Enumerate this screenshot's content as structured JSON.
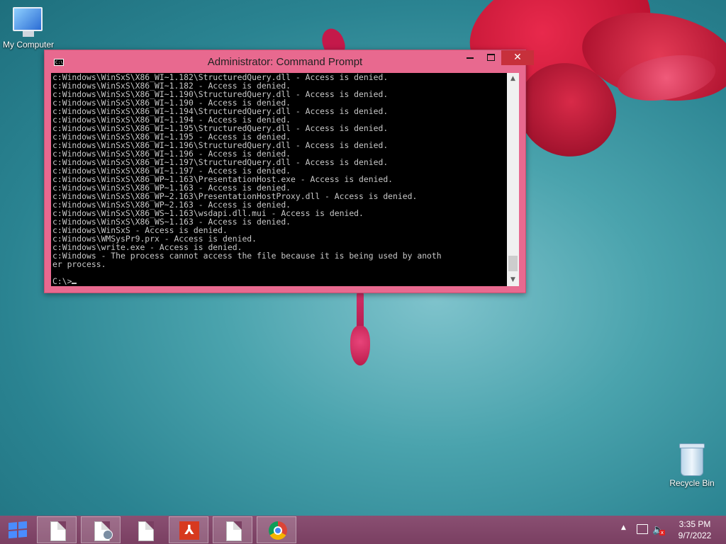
{
  "desktop": {
    "icons": [
      {
        "label": "My Computer"
      },
      {
        "label": "Recycle Bin"
      }
    ]
  },
  "window": {
    "title": "Administrator: Command Prompt",
    "icon_text": "C:\\",
    "controls": {
      "minimize": "",
      "maximize": "",
      "close": "✕"
    },
    "console_lines": [
      "c:Windows\\WinSxS\\X86_WI~1.182\\StructuredQuery.dll - Access is denied.",
      "c:Windows\\WinSxS\\X86_WI~1.182 - Access is denied.",
      "c:Windows\\WinSxS\\X86_WI~1.190\\StructuredQuery.dll - Access is denied.",
      "c:Windows\\WinSxS\\X86_WI~1.190 - Access is denied.",
      "c:Windows\\WinSxS\\X86_WI~1.194\\StructuredQuery.dll - Access is denied.",
      "c:Windows\\WinSxS\\X86_WI~1.194 - Access is denied.",
      "c:Windows\\WinSxS\\X86_WI~1.195\\StructuredQuery.dll - Access is denied.",
      "c:Windows\\WinSxS\\X86_WI~1.195 - Access is denied.",
      "c:Windows\\WinSxS\\X86_WI~1.196\\StructuredQuery.dll - Access is denied.",
      "c:Windows\\WinSxS\\X86_WI~1.196 - Access is denied.",
      "c:Windows\\WinSxS\\X86_WI~1.197\\StructuredQuery.dll - Access is denied.",
      "c:Windows\\WinSxS\\X86_WI~1.197 - Access is denied.",
      "c:Windows\\WinSxS\\X86_WP~1.163\\PresentationHost.exe - Access is denied.",
      "c:Windows\\WinSxS\\X86_WP~1.163 - Access is denied.",
      "c:Windows\\WinSxS\\X86_WP~2.163\\PresentationHostProxy.dll - Access is denied.",
      "c:Windows\\WinSxS\\X86_WP~2.163 - Access is denied.",
      "c:Windows\\WinSxS\\X86_WS~1.163\\wsdapi.dll.mui - Access is denied.",
      "c:Windows\\WinSxS\\X86_WS~1.163 - Access is denied.",
      "c:Windows\\WinSxS - Access is denied.",
      "c:Windows\\WMSysPr9.prx - Access is denied.",
      "c:Windows\\write.exe - Access is denied.",
      "c:Windows - The process cannot access the file because it is being used by anoth",
      "er process.",
      ""
    ],
    "prompt": "C:\\>"
  },
  "taskbar": {
    "clock_time": "3:35 PM",
    "clock_date": "9/7/2022",
    "tray_arrow": "▲",
    "volume_glyph": "🔈",
    "volume_x": "x",
    "acrobat_glyph": "⅄",
    "apps": [
      {
        "icon": "document-icon"
      },
      {
        "icon": "user-document-icon"
      },
      {
        "icon": "document-icon"
      },
      {
        "icon": "acrobat-icon"
      },
      {
        "icon": "document-icon"
      },
      {
        "icon": "chrome-icon"
      }
    ]
  }
}
